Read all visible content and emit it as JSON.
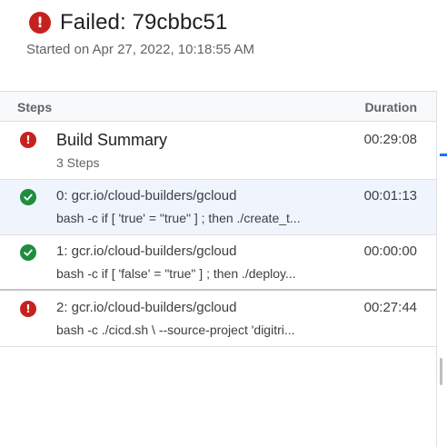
{
  "header": {
    "status_title": "Failed: 79cbbc51",
    "started_text": "Started on Apr 27, 2022, 10:18:55 AM",
    "status_icon": "error-icon",
    "status_color": "#c5221f"
  },
  "table": {
    "col_steps": "Steps",
    "col_duration": "Duration"
  },
  "summary": {
    "title": "Build Summary",
    "subtitle": "3 Steps",
    "duration": "00:29:08",
    "icon": "error-icon"
  },
  "steps": [
    {
      "name": "0: gcr.io/cloud-builders/gcloud",
      "command": "bash -c if [ 'true' = \"true\" ] ; then ./create_t...",
      "duration": "00:01:13",
      "status": "success",
      "selected": true
    },
    {
      "name": "1: gcr.io/cloud-builders/gcloud",
      "command": "bash -c if [ 'false' = \"true\" ] ; then ./deploy...",
      "duration": "00:00:00",
      "status": "success",
      "selected": false
    },
    {
      "name": "2: gcr.io/cloud-builders/gcloud",
      "command": "bash -c ./cicd.sh \\ --source-project 'digitri...",
      "duration": "00:27:44",
      "status": "error",
      "selected": false
    }
  ],
  "colors": {
    "success": "#1e8e3e",
    "error": "#c5221f",
    "accent": "#1a73e8"
  }
}
